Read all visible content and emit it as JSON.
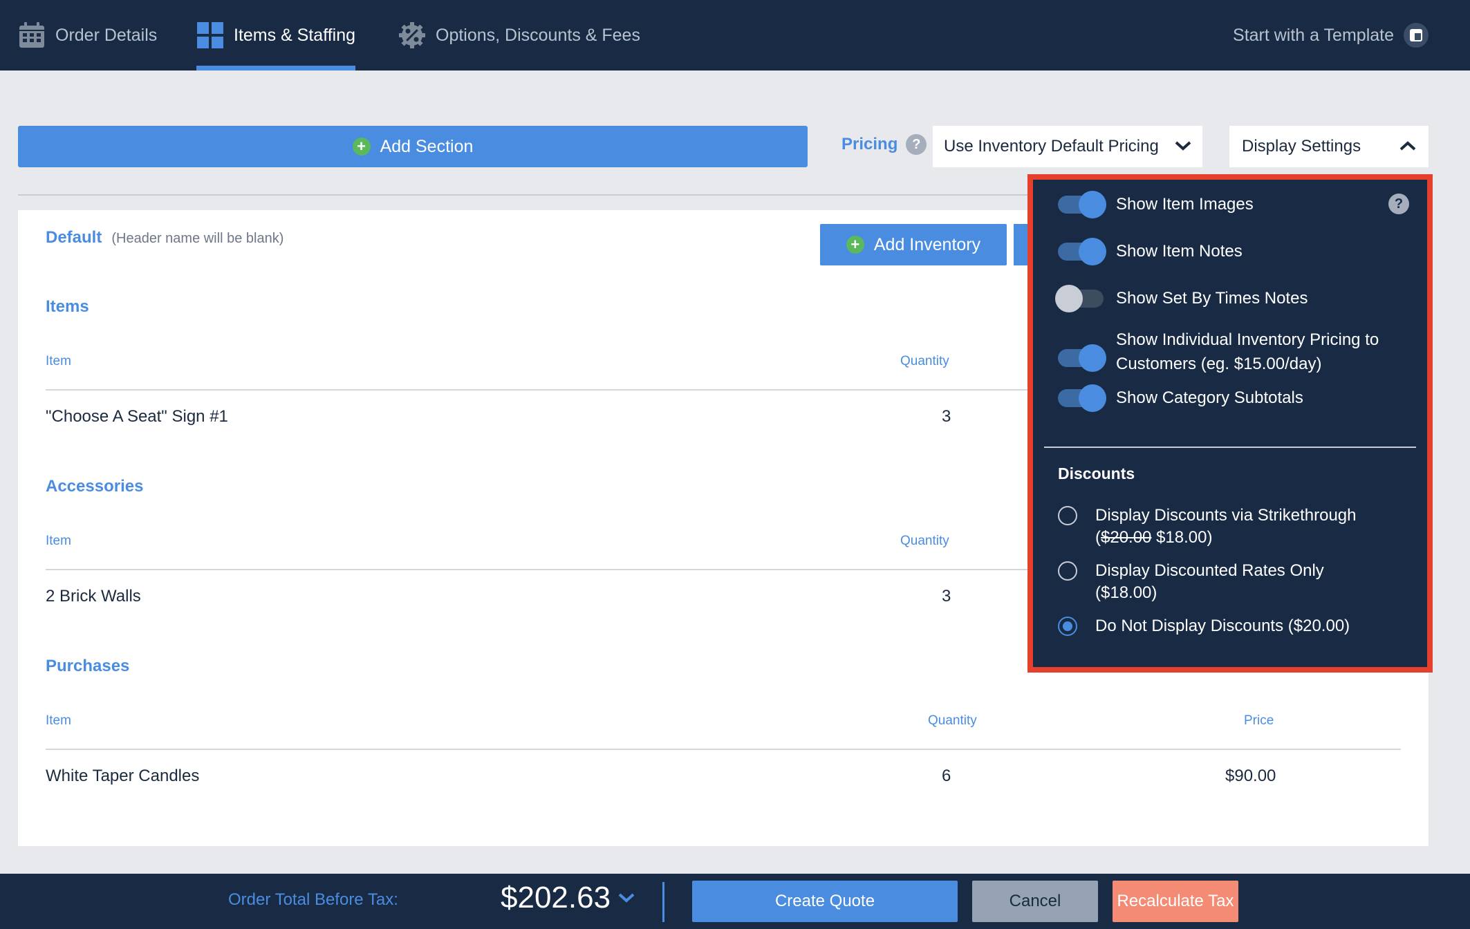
{
  "nav": {
    "tabs": [
      {
        "label": "Order Details",
        "icon": "calendar-icon"
      },
      {
        "label": "Items & Staffing",
        "icon": "grid-icon",
        "active": true
      },
      {
        "label": "Options, Discounts & Fees",
        "icon": "discount-gear-icon"
      }
    ],
    "template_link": "Start with a Template"
  },
  "toolbar": {
    "add_section": "Add Section",
    "pricing_label": "Pricing",
    "pricing_help": "?",
    "pricing_value": "Use Inventory Default Pricing",
    "display_settings": "Display Settings"
  },
  "section": {
    "name": "Default",
    "note": "(Header name will be blank)",
    "add_inventory": "Add Inventory",
    "groups": [
      {
        "title": "Items",
        "col_item": "Item",
        "col_quantity": "Quantity",
        "rows": [
          {
            "item": "\"Choose A Seat\" Sign #1",
            "quantity": "3"
          }
        ]
      },
      {
        "title": "Accessories",
        "col_item": "Item",
        "col_quantity": "Quantity",
        "rows": [
          {
            "item": "2 Brick Walls",
            "quantity": "3"
          }
        ]
      },
      {
        "title": "Purchases",
        "col_item": "Item",
        "col_quantity": "Quantity",
        "col_price": "Price",
        "rows": [
          {
            "item": "White Taper Candles",
            "quantity": "6",
            "price": "$90.00"
          }
        ]
      }
    ]
  },
  "display_popover": {
    "help": "?",
    "toggles": [
      {
        "label": "Show Item Images",
        "on": true
      },
      {
        "label": "Show Item Notes",
        "on": true
      },
      {
        "label": "Show Set By Times Notes",
        "on": false
      },
      {
        "label": "Show Individual Inventory Pricing to Customers (eg. $15.00/day)",
        "on": true
      },
      {
        "label": "Show Category Subtotals",
        "on": true
      }
    ],
    "discounts_title": "Discounts",
    "discount_options": [
      {
        "label_prefix": "Display Discounts via Strikethrough (",
        "label_strike": "$20.00",
        "label_suffix": " $18.00)",
        "checked": false
      },
      {
        "label": "Display Discounted Rates Only ($18.00)",
        "checked": false
      },
      {
        "label": "Do Not Display Discounts ($20.00)",
        "checked": true
      }
    ],
    "highlight_color": "#e4402b"
  },
  "footer": {
    "total_label": "Order Total Before Tax:",
    "total_value": "$202.63",
    "create_quote": "Create Quote",
    "cancel": "Cancel",
    "recalculate_tax": "Recalculate Tax"
  },
  "colors": {
    "navy": "#182a44",
    "accent_blue": "#4a8de0",
    "add_green": "#5cb85c",
    "recalc_salmon": "#f38b75",
    "cancel_gray": "#96a3b5"
  }
}
